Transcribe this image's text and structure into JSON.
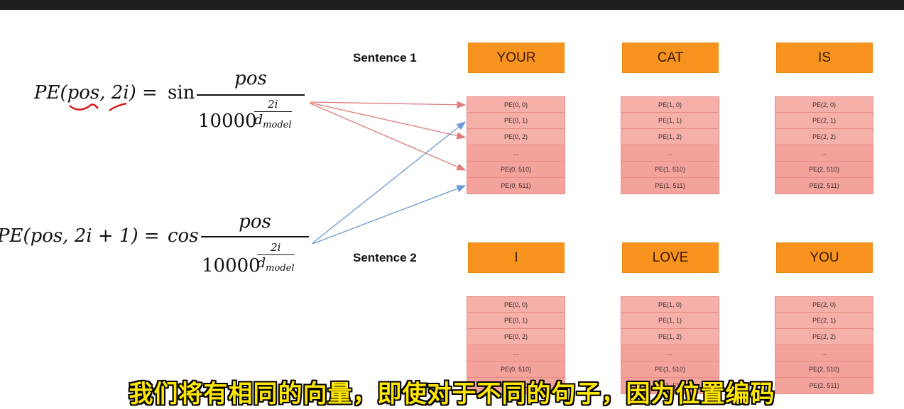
{
  "formula_sin": {
    "lhs": "PE(pos, 2i) =",
    "func": "sin",
    "numerator": "pos",
    "base": "10000",
    "exp_top": "2i",
    "exp_bot": "d",
    "exp_sub": "model"
  },
  "formula_cos": {
    "lhs": "PE(pos, 2i + 1) =",
    "func": "cos",
    "numerator": "pos",
    "base": "10000",
    "exp_top": "2i",
    "exp_bot": "d",
    "exp_sub": "model"
  },
  "colors": {
    "word_box": "#f7931e",
    "pe_cell": "#f6b0aa",
    "arrow_sin": "#e07b7b",
    "arrow_cos": "#6a9bd8",
    "subtitle": "#ffe600"
  },
  "sentences": [
    {
      "label": "Sentence 1",
      "words": [
        {
          "word": "YOUR",
          "pe": [
            "PE(0, 0)",
            "PE(0, 1)",
            "PE(0, 2)",
            "...",
            "PE(0, 510)",
            "PE(0, 511)"
          ]
        },
        {
          "word": "CAT",
          "pe": [
            "PE(1, 0)",
            "PE(1, 1)",
            "PE(1, 2)",
            "...",
            "PE(1, 510)",
            "PE(1, 511)"
          ]
        },
        {
          "word": "IS",
          "pe": [
            "PE(2, 0)",
            "PE(2, 1)",
            "PE(2, 2)",
            "...",
            "PE(2, 510)",
            "PE(2, 511)"
          ]
        }
      ]
    },
    {
      "label": "Sentence 2",
      "words": [
        {
          "word": "I",
          "pe": [
            "PE(0, 0)",
            "PE(0, 1)",
            "PE(0, 2)",
            "...",
            "PE(0, 510)",
            "PE(0, 511)"
          ]
        },
        {
          "word": "LOVE",
          "pe": [
            "PE(1, 0)",
            "PE(1, 1)",
            "PE(1, 2)",
            "...",
            "PE(1, 510)",
            "PE(1, 511)"
          ]
        },
        {
          "word": "YOU",
          "pe": [
            "PE(2, 0)",
            "PE(2, 1)",
            "PE(2, 2)",
            "...",
            "PE(2, 510)",
            "PE(2, 511)"
          ]
        }
      ]
    }
  ],
  "subtitle": "我们将有相同的向量，即使对于不同的句子，因为位置编码"
}
